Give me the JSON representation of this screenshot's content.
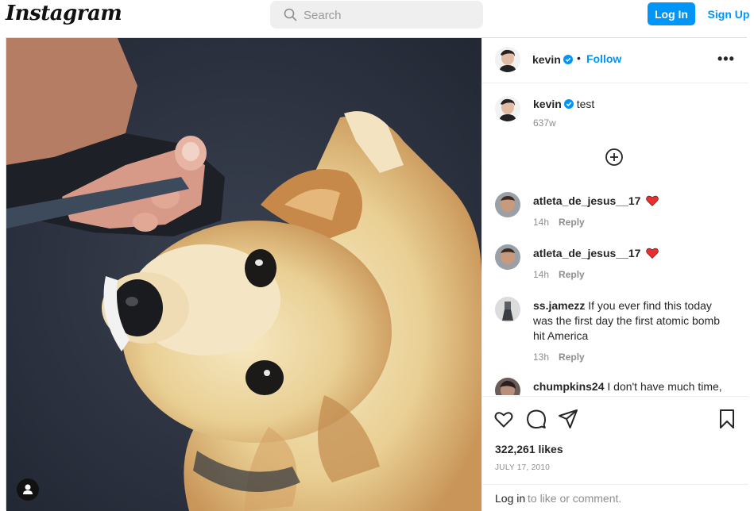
{
  "topbar": {
    "logo": "Instagram",
    "search_placeholder": "Search",
    "login_label": "Log In",
    "signup_label": "Sign Up"
  },
  "post": {
    "author": "kevin",
    "follow_label": "Follow",
    "separator": "•",
    "more_label": "•••",
    "caption": "test",
    "caption_time": "637w",
    "comments": [
      {
        "user": "atleta_de_jesus__17",
        "text": "",
        "heart_emoji": true,
        "time": "14h",
        "reply": "Reply"
      },
      {
        "user": "atleta_de_jesus__17",
        "text": "",
        "heart_emoji": true,
        "time": "14h",
        "reply": "Reply"
      },
      {
        "user": "ss.jamezz",
        "text": "If you ever find this today was the first day the first atomic bomb hit America",
        "time": "13h",
        "reply": "Reply"
      },
      {
        "user": "chumpkins24",
        "text": "I don't have much time,",
        "time": "",
        "reply": ""
      }
    ],
    "likes": "322,261 likes",
    "date": "JULY 17, 2010",
    "login_prompt": {
      "link": "Log in",
      "rest": "to like or comment."
    }
  },
  "colors": {
    "accent": "#0095f6",
    "verified": "#0095f6",
    "heart": "#ed2d2d",
    "muted": "#8e8e8e"
  },
  "icons": [
    "search-icon",
    "verified-icon",
    "more-icon",
    "add-circle-icon",
    "heart-icon",
    "comment-icon",
    "share-icon",
    "bookmark-icon",
    "user-tag-icon"
  ]
}
